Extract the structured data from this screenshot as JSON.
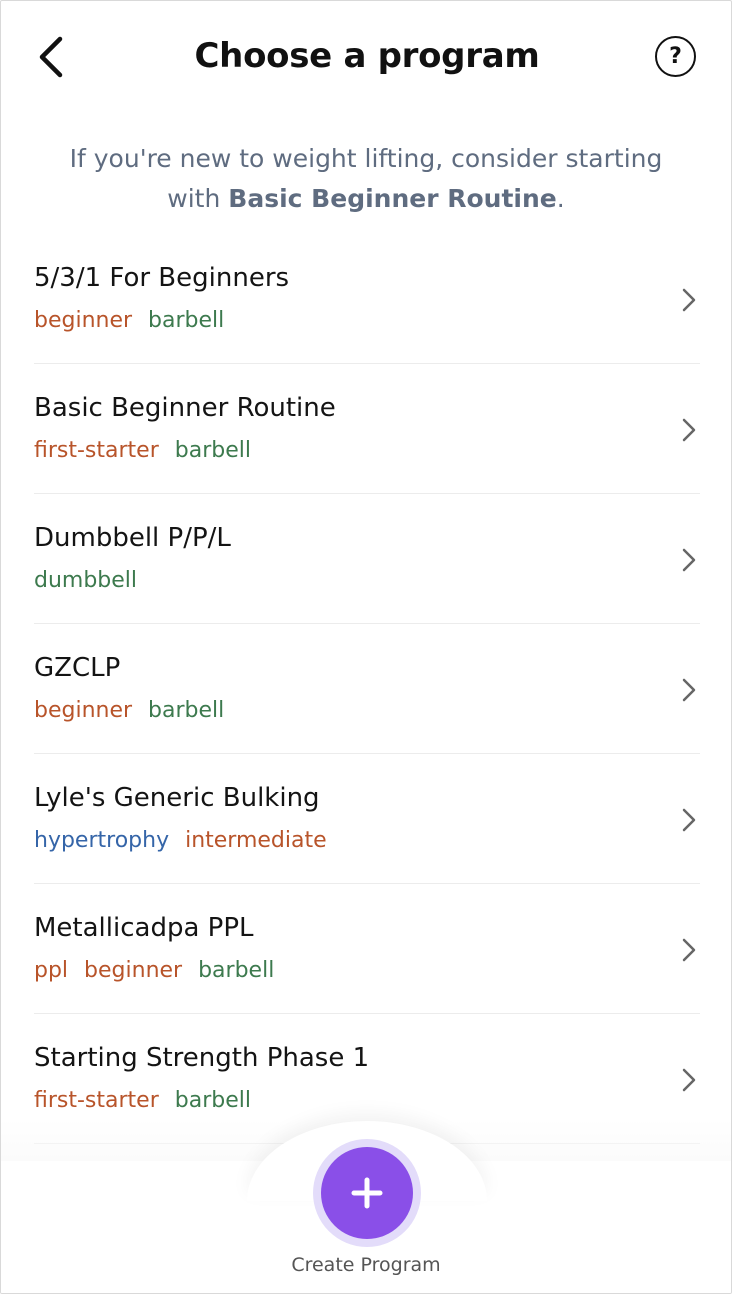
{
  "header": {
    "title": "Choose a program",
    "help_label": "?"
  },
  "intro": {
    "text_before": "If you're new to weight lifting, consider starting with ",
    "highlight": "Basic Beginner Routine",
    "text_after": "."
  },
  "programs": [
    {
      "name": "5/3/1 For Beginners",
      "tags": [
        {
          "label": "beginner",
          "color": "orange"
        },
        {
          "label": "barbell",
          "color": "green"
        }
      ]
    },
    {
      "name": "Basic Beginner Routine",
      "tags": [
        {
          "label": "first-starter",
          "color": "orange"
        },
        {
          "label": "barbell",
          "color": "green"
        }
      ]
    },
    {
      "name": "Dumbbell P/P/L",
      "tags": [
        {
          "label": "dumbbell",
          "color": "green"
        }
      ]
    },
    {
      "name": "GZCLP",
      "tags": [
        {
          "label": "beginner",
          "color": "orange"
        },
        {
          "label": "barbell",
          "color": "green"
        }
      ]
    },
    {
      "name": "Lyle's Generic Bulking",
      "tags": [
        {
          "label": "hypertrophy",
          "color": "blue"
        },
        {
          "label": "intermediate",
          "color": "orange"
        }
      ]
    },
    {
      "name": "Metallicadpa PPL",
      "tags": [
        {
          "label": "ppl",
          "color": "orange"
        },
        {
          "label": "beginner",
          "color": "orange"
        },
        {
          "label": "barbell",
          "color": "green"
        }
      ]
    },
    {
      "name": "Starting Strength Phase 1",
      "tags": [
        {
          "label": "first-starter",
          "color": "orange"
        },
        {
          "label": "barbell",
          "color": "green"
        }
      ]
    }
  ],
  "footer": {
    "create_label": "Create Program",
    "fab_icon": "plus-icon"
  },
  "colors": {
    "accent": "#8a4fe8",
    "accent_ring": "#e3dcfa",
    "tag_orange": "#b8542a",
    "tag_green": "#3d7a4e",
    "tag_blue": "#3565a8",
    "intro_text": "#5f6c80"
  }
}
